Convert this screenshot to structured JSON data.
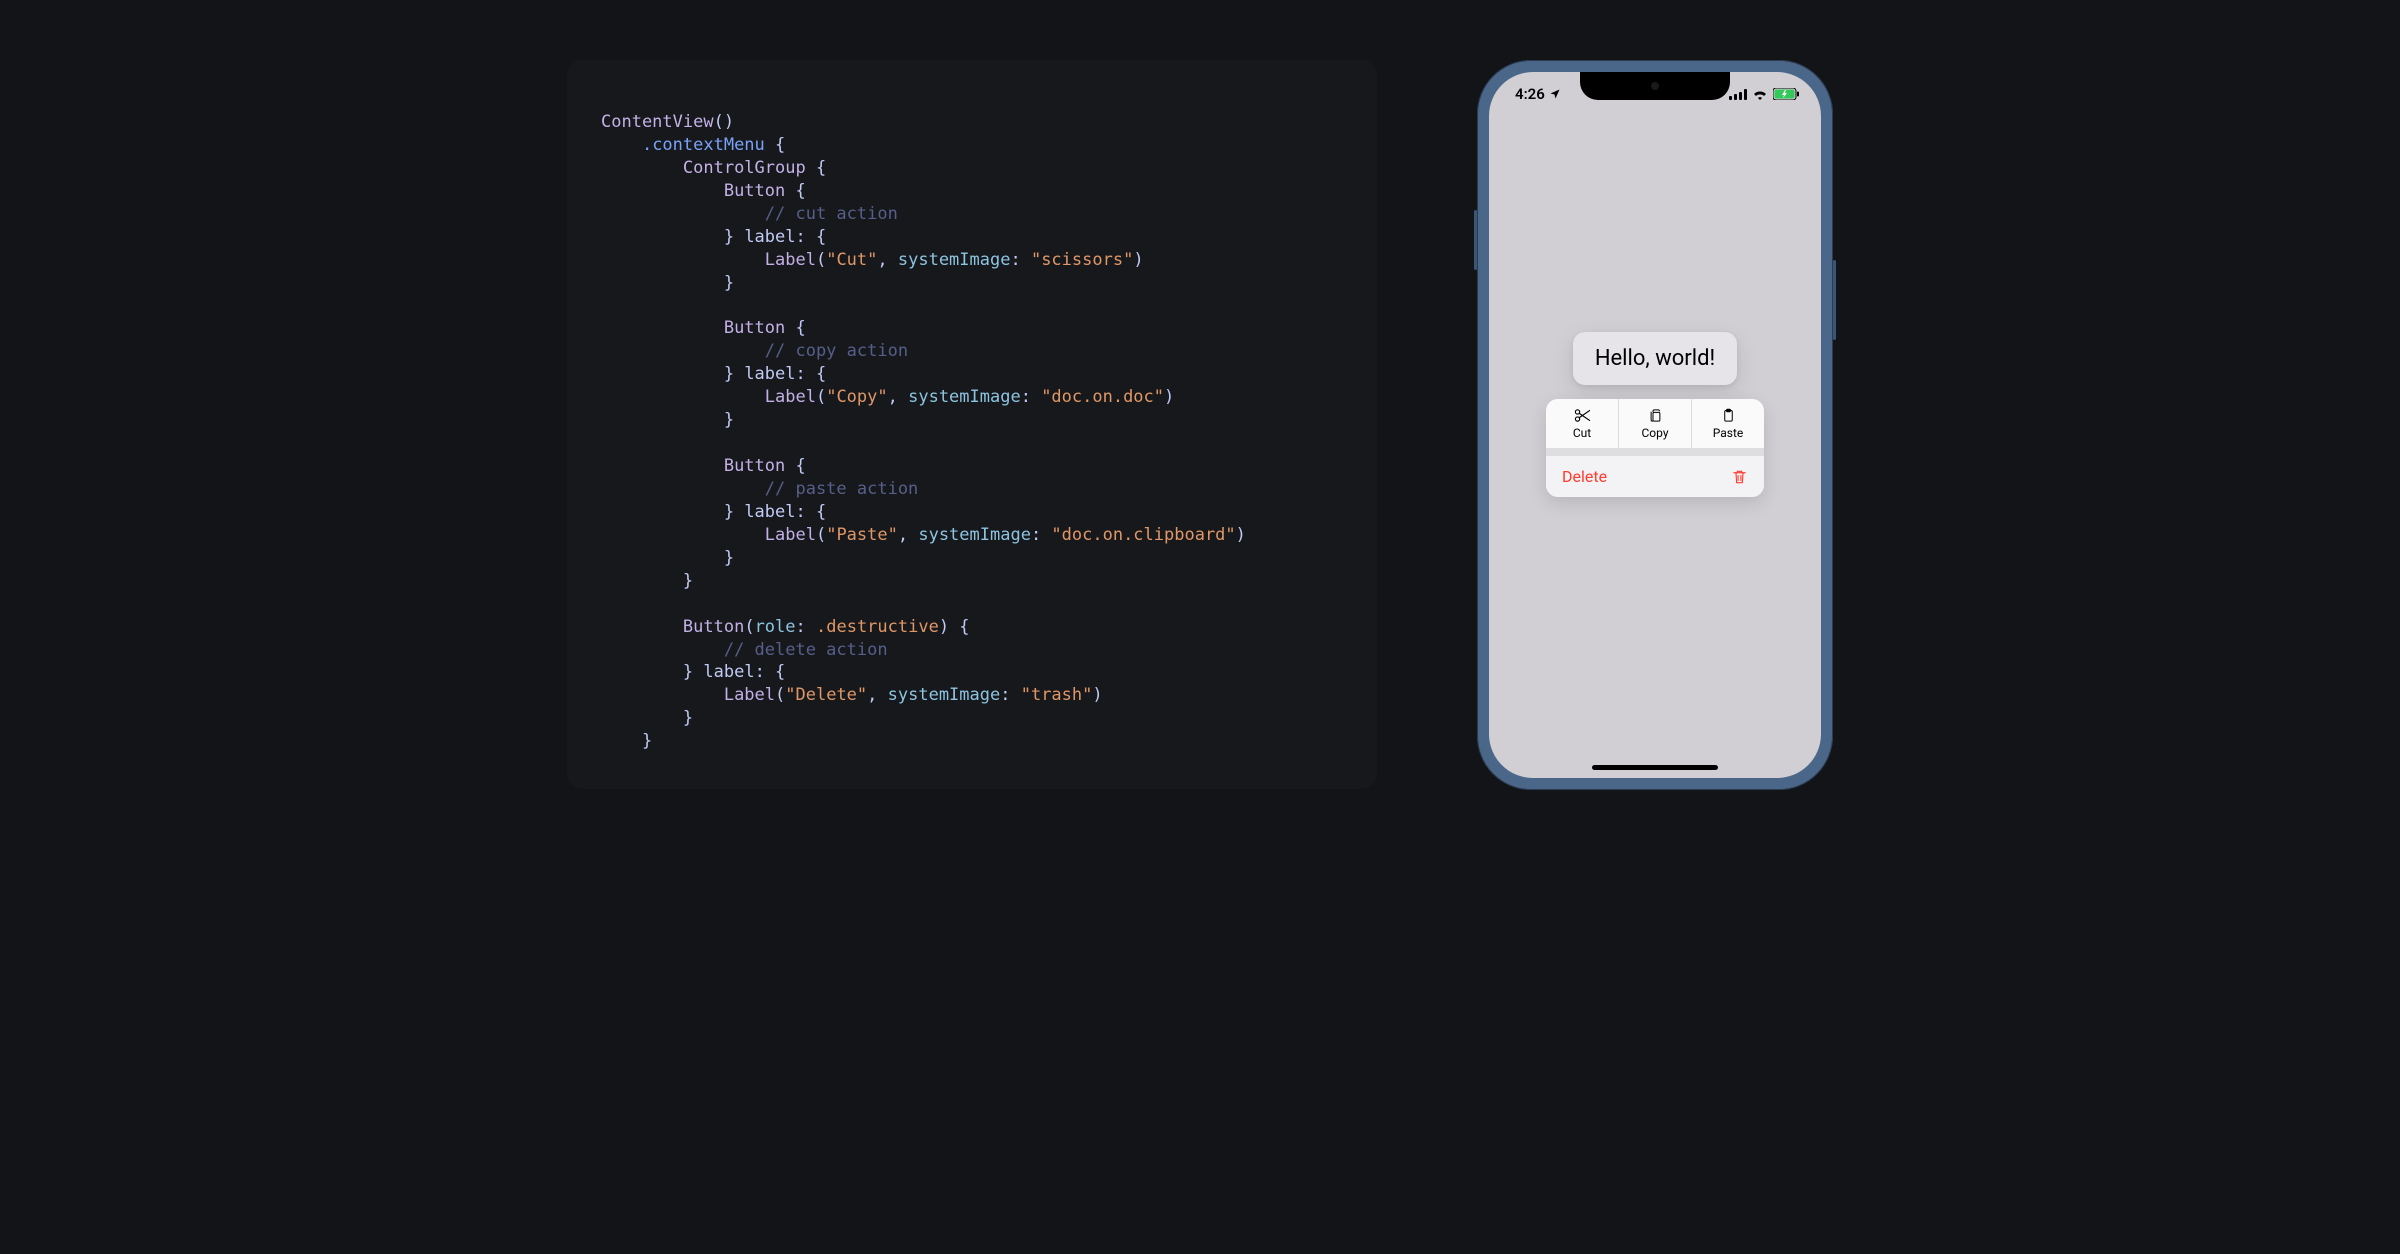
{
  "code": {
    "struct_name": "ContentView",
    "modifier": ".contextMenu",
    "control_group": "ControlGroup",
    "button": "Button",
    "label_fn": "Label",
    "label_kw": "label",
    "system_image_kw": "systemImage",
    "role_kw": "role",
    "role_value": ".destructive",
    "comments": {
      "cut": "// cut action",
      "copy": "// copy action",
      "paste": "// paste action",
      "delete": "// delete action"
    },
    "strings": {
      "cut": "\"Cut\"",
      "copy": "\"Copy\"",
      "paste": "\"Paste\"",
      "delete": "\"Delete\"",
      "scissors": "\"scissors\"",
      "docondoc": "\"doc.on.doc\"",
      "doconclipboard": "\"doc.on.clipboard\"",
      "trash": "\"trash\""
    }
  },
  "phone": {
    "status_time": "4:26",
    "preview_text": "Hello, world!",
    "menu": {
      "cut": "Cut",
      "copy": "Copy",
      "paste": "Paste",
      "delete": "Delete"
    },
    "icons": {
      "location": "location-arrow-icon",
      "signal": "cellular-signal-icon",
      "wifi": "wifi-icon",
      "battery": "battery-charging-icon",
      "scissors": "scissors-icon",
      "docondoc": "doc-on-doc-icon",
      "clipboard": "doc-on-clipboard-icon",
      "trash": "trash-icon"
    }
  }
}
